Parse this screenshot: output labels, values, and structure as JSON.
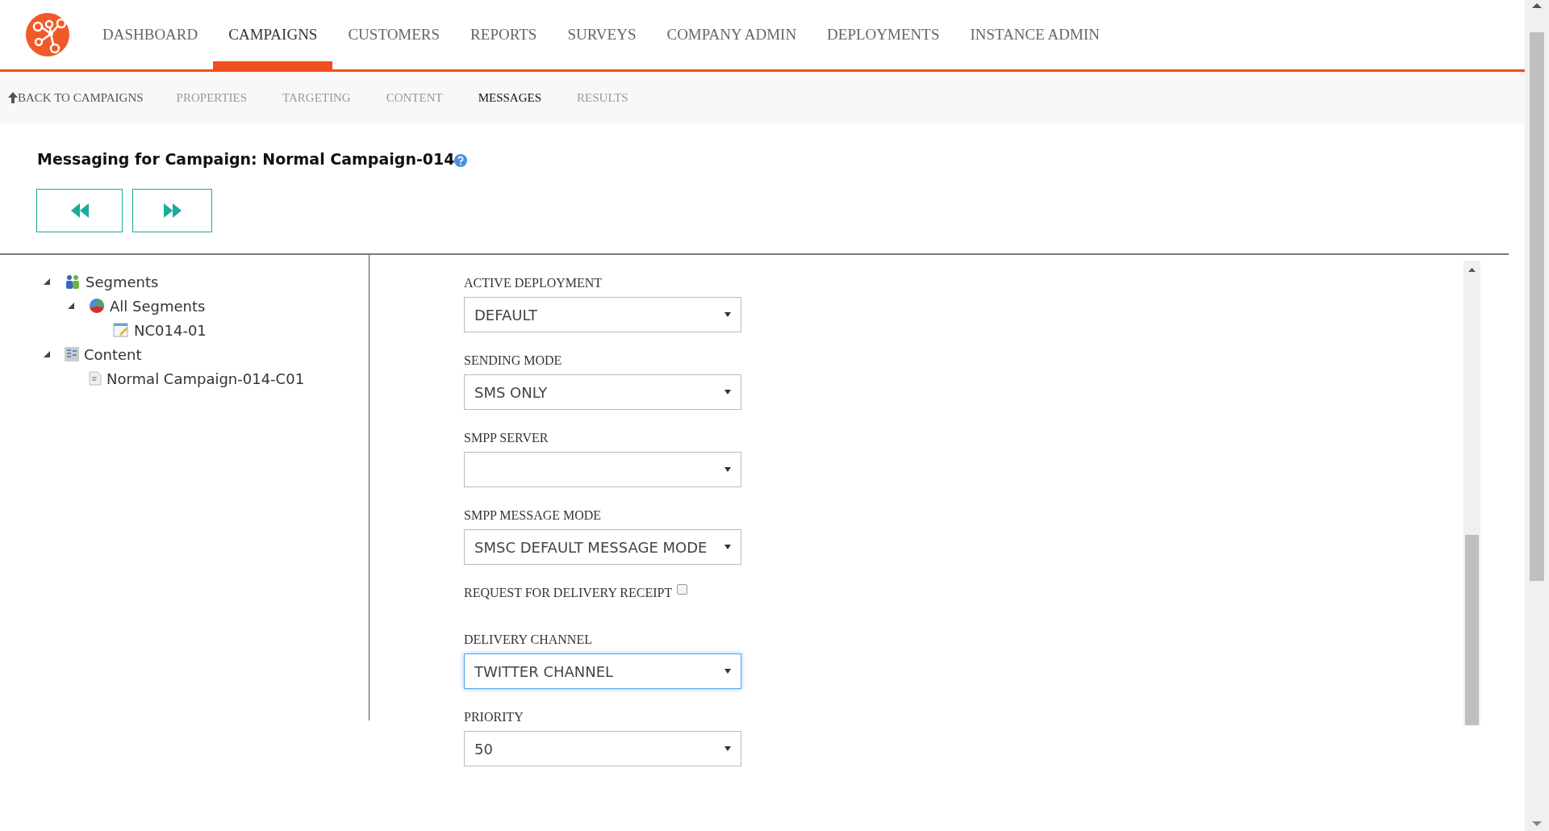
{
  "top_nav": [
    {
      "label": "DASHBOARD",
      "selected": false
    },
    {
      "label": "CAMPAIGNS",
      "selected": true
    },
    {
      "label": "CUSTOMERS",
      "selected": false
    },
    {
      "label": "REPORTS",
      "selected": false
    },
    {
      "label": "SURVEYS",
      "selected": false
    },
    {
      "label": "COMPANY ADMIN",
      "selected": false
    },
    {
      "label": "DEPLOYMENTS",
      "selected": false
    },
    {
      "label": "INSTANCE ADMIN",
      "selected": false
    }
  ],
  "sub_nav": {
    "back_link": "BACK TO CAMPAIGNS",
    "tabs": [
      {
        "label": "PROPERTIES",
        "selected": false
      },
      {
        "label": "TARGETING",
        "selected": false
      },
      {
        "label": "CONTENT",
        "selected": false
      },
      {
        "label": "MESSAGES",
        "selected": true
      },
      {
        "label": "RESULTS",
        "selected": false
      }
    ]
  },
  "page_title": "Messaging for Campaign: Normal Campaign-014",
  "tree": [
    {
      "label": "Segments",
      "kind": "segments",
      "expanded": true,
      "children": [
        {
          "label": "All Segments",
          "kind": "pie",
          "expanded": true,
          "children": [
            {
              "label": "NC014-01",
              "kind": "note"
            }
          ]
        }
      ]
    },
    {
      "label": "Content",
      "kind": "content",
      "expanded": true,
      "children": [
        {
          "label": "Normal Campaign-014-C01",
          "kind": "doc"
        }
      ]
    }
  ],
  "form": [
    {
      "kind": "select",
      "label": "ACTIVE DEPLOYMENT",
      "value": "DEFAULT",
      "focused": false
    },
    {
      "kind": "select",
      "label": "SENDING MODE",
      "value": "SMS ONLY",
      "focused": false
    },
    {
      "kind": "select",
      "label": "SMPP SERVER",
      "focused": false
    },
    {
      "kind": "select",
      "label": "SMPP MESSAGE MODE",
      "value": "SMSC DEFAULT MESSAGE MODE",
      "focused": false
    },
    {
      "kind": "checkbox",
      "label": "REQUEST FOR DELIVERY RECEIPT",
      "checked": false
    },
    {
      "kind": "select",
      "label": "DELIVERY CHANNEL",
      "value": "TWITTER CHANNEL",
      "focused": true
    },
    {
      "kind": "select",
      "label": "PRIORITY",
      "value": "50",
      "focused": false
    }
  ]
}
